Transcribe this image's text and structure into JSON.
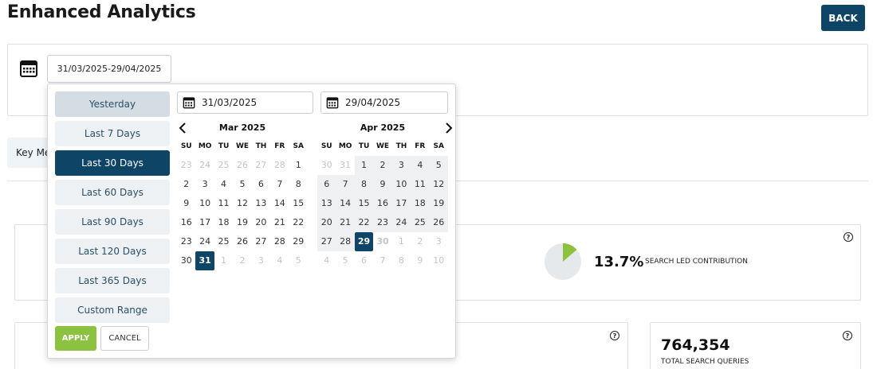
{
  "header": {
    "title": "Enhanced Analytics",
    "back_label": "BACK"
  },
  "filter": {
    "date_range_value": "31/03/2025-29/04/2025"
  },
  "tabs": {
    "key_metrics_label": "Key Metrics"
  },
  "metrics": {
    "search_led": {
      "value": "13.7%",
      "label": "SEARCH LED CONTRIBUTION",
      "fraction": 0.137
    },
    "total_queries": {
      "value": "764,354",
      "label": "TOTAL SEARCH QUERIES"
    }
  },
  "datepicker": {
    "ranges": [
      {
        "label": "Yesterday",
        "state": "hovered"
      },
      {
        "label": "Last 7 Days",
        "state": ""
      },
      {
        "label": "Last 30 Days",
        "state": "active"
      },
      {
        "label": "Last 60 Days",
        "state": ""
      },
      {
        "label": "Last 90 Days",
        "state": ""
      },
      {
        "label": "Last 120 Days",
        "state": ""
      },
      {
        "label": "Last 365 Days",
        "state": ""
      },
      {
        "label": "Custom Range",
        "state": ""
      }
    ],
    "apply_label": "APPLY",
    "cancel_label": "CANCEL",
    "start_input": "31/03/2025",
    "end_input": "29/04/2025",
    "weekdays": [
      "SU",
      "MO",
      "TU",
      "WE",
      "TH",
      "FR",
      "SA"
    ],
    "calendars": [
      {
        "month": "Mar 2025",
        "weeks": [
          [
            {
              "d": "23",
              "c": "off"
            },
            {
              "d": "24",
              "c": "off"
            },
            {
              "d": "25",
              "c": "off"
            },
            {
              "d": "26",
              "c": "off"
            },
            {
              "d": "27",
              "c": "off"
            },
            {
              "d": "28",
              "c": "off"
            },
            {
              "d": "1",
              "c": ""
            }
          ],
          [
            {
              "d": "2",
              "c": ""
            },
            {
              "d": "3",
              "c": ""
            },
            {
              "d": "4",
              "c": ""
            },
            {
              "d": "5",
              "c": ""
            },
            {
              "d": "6",
              "c": ""
            },
            {
              "d": "7",
              "c": ""
            },
            {
              "d": "8",
              "c": ""
            }
          ],
          [
            {
              "d": "9",
              "c": ""
            },
            {
              "d": "10",
              "c": ""
            },
            {
              "d": "11",
              "c": ""
            },
            {
              "d": "12",
              "c": ""
            },
            {
              "d": "13",
              "c": ""
            },
            {
              "d": "14",
              "c": ""
            },
            {
              "d": "15",
              "c": ""
            }
          ],
          [
            {
              "d": "16",
              "c": ""
            },
            {
              "d": "17",
              "c": ""
            },
            {
              "d": "18",
              "c": ""
            },
            {
              "d": "19",
              "c": ""
            },
            {
              "d": "20",
              "c": ""
            },
            {
              "d": "21",
              "c": ""
            },
            {
              "d": "22",
              "c": ""
            }
          ],
          [
            {
              "d": "23",
              "c": ""
            },
            {
              "d": "24",
              "c": ""
            },
            {
              "d": "25",
              "c": ""
            },
            {
              "d": "26",
              "c": ""
            },
            {
              "d": "27",
              "c": ""
            },
            {
              "d": "28",
              "c": ""
            },
            {
              "d": "29",
              "c": ""
            }
          ],
          [
            {
              "d": "30",
              "c": ""
            },
            {
              "d": "31",
              "c": "selected"
            },
            {
              "d": "1",
              "c": "off"
            },
            {
              "d": "2",
              "c": "off"
            },
            {
              "d": "3",
              "c": "off"
            },
            {
              "d": "4",
              "c": "off"
            },
            {
              "d": "5",
              "c": "off"
            }
          ]
        ]
      },
      {
        "month": "Apr 2025",
        "weeks": [
          [
            {
              "d": "30",
              "c": "off"
            },
            {
              "d": "31",
              "c": "off"
            },
            {
              "d": "1",
              "c": "in-range"
            },
            {
              "d": "2",
              "c": "in-range"
            },
            {
              "d": "3",
              "c": "in-range"
            },
            {
              "d": "4",
              "c": "in-range"
            },
            {
              "d": "5",
              "c": "in-range"
            }
          ],
          [
            {
              "d": "6",
              "c": "in-range"
            },
            {
              "d": "7",
              "c": "in-range"
            },
            {
              "d": "8",
              "c": "in-range"
            },
            {
              "d": "9",
              "c": "in-range"
            },
            {
              "d": "10",
              "c": "in-range"
            },
            {
              "d": "11",
              "c": "in-range"
            },
            {
              "d": "12",
              "c": "in-range"
            }
          ],
          [
            {
              "d": "13",
              "c": "in-range"
            },
            {
              "d": "14",
              "c": "in-range"
            },
            {
              "d": "15",
              "c": "in-range"
            },
            {
              "d": "16",
              "c": "in-range"
            },
            {
              "d": "17",
              "c": "in-range"
            },
            {
              "d": "18",
              "c": "in-range"
            },
            {
              "d": "19",
              "c": "in-range"
            }
          ],
          [
            {
              "d": "20",
              "c": "in-range"
            },
            {
              "d": "21",
              "c": "in-range"
            },
            {
              "d": "22",
              "c": "in-range"
            },
            {
              "d": "23",
              "c": "in-range"
            },
            {
              "d": "24",
              "c": "in-range"
            },
            {
              "d": "25",
              "c": "in-range"
            },
            {
              "d": "26",
              "c": "in-range"
            }
          ],
          [
            {
              "d": "27",
              "c": "in-range"
            },
            {
              "d": "28",
              "c": "in-range"
            },
            {
              "d": "29",
              "c": "selected"
            },
            {
              "d": "30",
              "c": "off today"
            },
            {
              "d": "1",
              "c": "off"
            },
            {
              "d": "2",
              "c": "off"
            },
            {
              "d": "3",
              "c": "off"
            }
          ],
          [
            {
              "d": "4",
              "c": "off"
            },
            {
              "d": "5",
              "c": "off"
            },
            {
              "d": "6",
              "c": "off"
            },
            {
              "d": "7",
              "c": "off"
            },
            {
              "d": "8",
              "c": "off"
            },
            {
              "d": "9",
              "c": "off"
            },
            {
              "d": "10",
              "c": "off"
            }
          ]
        ]
      }
    ]
  },
  "colors": {
    "primary": "#0e4466",
    "apply": "#8cc23f",
    "pie_fill": "#8cc23f",
    "pie_track": "#e6e9ec"
  }
}
